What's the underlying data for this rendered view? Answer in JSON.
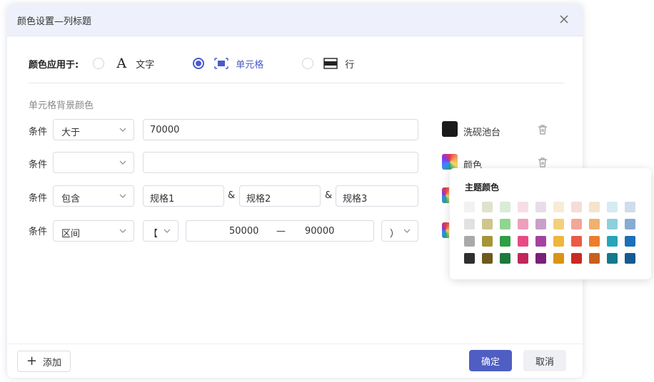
{
  "dialog": {
    "title": "颜色设置—列标题",
    "apply_label": "颜色应用于:",
    "options": [
      {
        "icon": "text-icon",
        "glyph": "A",
        "label": "文字",
        "checked": false
      },
      {
        "icon": "cell-icon",
        "label": "单元格",
        "checked": true
      },
      {
        "icon": "row-icon",
        "label": "行",
        "checked": false
      }
    ],
    "section_title": "单元格背景颜色",
    "conditions": [
      {
        "label": "条件",
        "operator": "大于",
        "value": "70000",
        "swatch_color": "#1a1a1a",
        "swatch_label": "洗砚池台"
      },
      {
        "label": "条件",
        "operator": "",
        "value": "",
        "swatch_color": "gradient",
        "swatch_label": "颜色"
      },
      {
        "label": "条件",
        "operator": "包含",
        "values": [
          "规格1",
          "规格2",
          "规格3"
        ],
        "separator": "&"
      },
      {
        "label": "条件",
        "operator": "区间",
        "open_bracket": "【",
        "from": "50000",
        "dash": "—",
        "to": "90000",
        "close_bracket": "）"
      }
    ],
    "add_label": "添加",
    "ok_label": "确定",
    "cancel_label": "取消"
  },
  "theme_popup": {
    "title": "主题颜色",
    "colors": [
      [
        "#f2f2f2",
        "#dfe3cd",
        "#d9ecd9",
        "#f7dde6",
        "#e8dde8",
        "#f7ecd7",
        "#f6dcd6",
        "#f4e4cc",
        "#d6ecf0",
        "#cfdcea"
      ],
      [
        "#e1e1e1",
        "#cfc58e",
        "#8fd58f",
        "#ef9fbd",
        "#c99fc9",
        "#f3cf7a",
        "#f2a798",
        "#f0b070",
        "#8fcfdc",
        "#86acd2"
      ],
      [
        "#a9a9a9",
        "#a69438",
        "#2f9e44",
        "#e84a86",
        "#a4439e",
        "#f0b53c",
        "#ea5a47",
        "#ee7c2a",
        "#27a4ba",
        "#1c6fb8"
      ],
      [
        "#2f2f2f",
        "#6e5a1c",
        "#1d7a3d",
        "#c2255c",
        "#7b1f77",
        "#d99413",
        "#c92a23",
        "#c85f1d",
        "#15788c",
        "#165a92"
      ]
    ]
  },
  "accent": "#4f5ec2"
}
